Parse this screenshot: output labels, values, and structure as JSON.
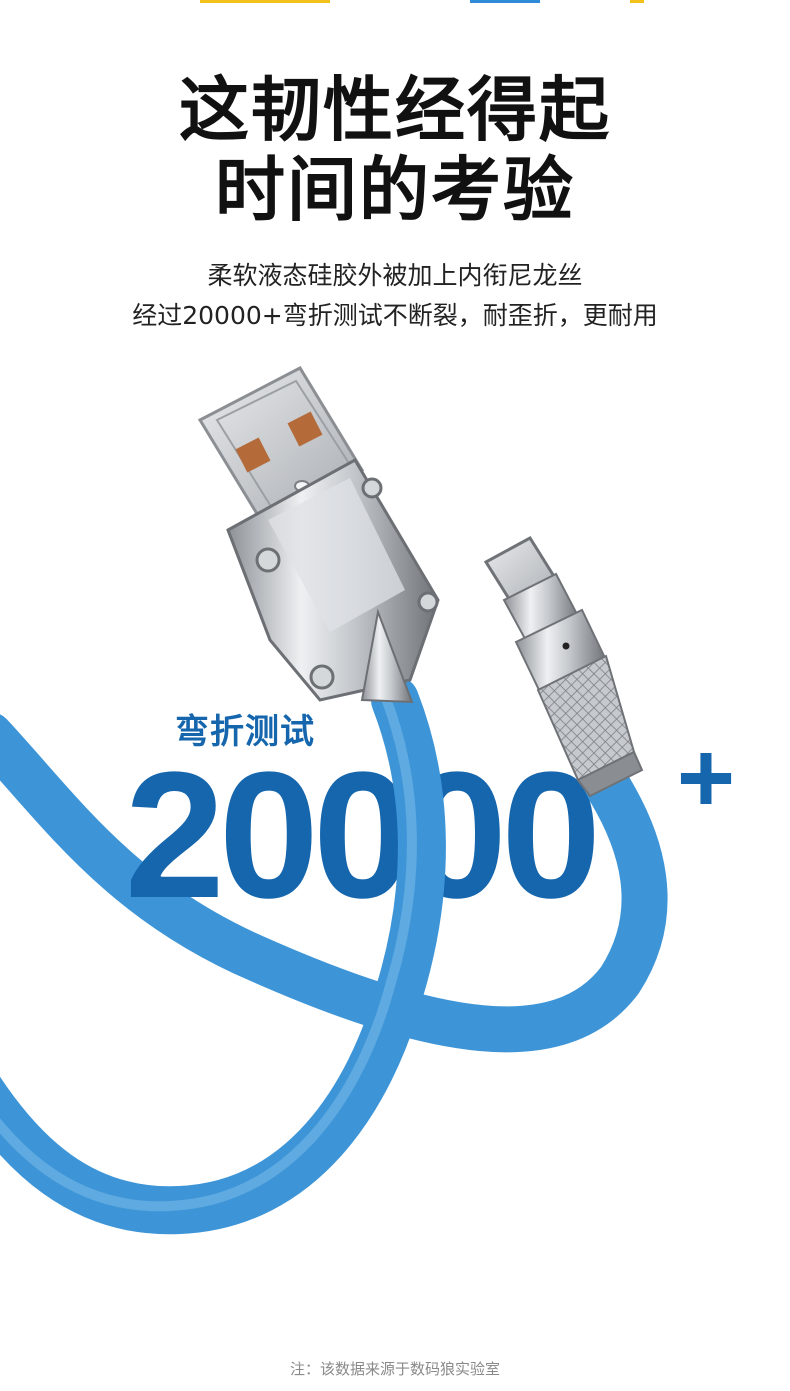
{
  "headline": {
    "line1": "这韧性经得起",
    "line2": "时间的考验"
  },
  "subtitle": {
    "line1": "柔软液态硅胶外被加上内衔尼龙丝",
    "line2": "经过20000+弯折测试不断裂，耐歪折，更耐用"
  },
  "bend_test": {
    "label": "弯折测试",
    "count": "20000",
    "plus": "+"
  },
  "footnote": "注：该数据来源于数码狼实验室",
  "colors": {
    "accent_blue": "#1566ad",
    "cable_blue": "#3d95d8",
    "metal": "#c9ccd0",
    "usb_contact": "#b56a3a",
    "top_strip_yellow": "#f2c21b",
    "top_strip_blue": "#2f8ad7"
  },
  "icons": {
    "usb_a_connector": "usb-a-connector-icon",
    "usb_c_connector": "usb-c-connector-icon"
  }
}
